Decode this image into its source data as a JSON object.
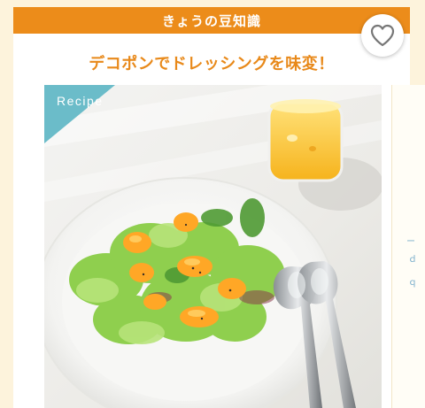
{
  "header": {
    "title": "きょうの豆知識"
  },
  "article": {
    "headline": "デコポンでドレッシングを味変！"
  },
  "photo": {
    "badge_label": "Recipe",
    "description_icon": "salad-photo"
  },
  "favorite": {
    "icon": "heart-icon"
  },
  "colors": {
    "header_bg": "#ec8c1a",
    "headline_text": "#e8891a",
    "badge_bg": "#6bbcc9",
    "page_bg": "#fdf3dc"
  }
}
